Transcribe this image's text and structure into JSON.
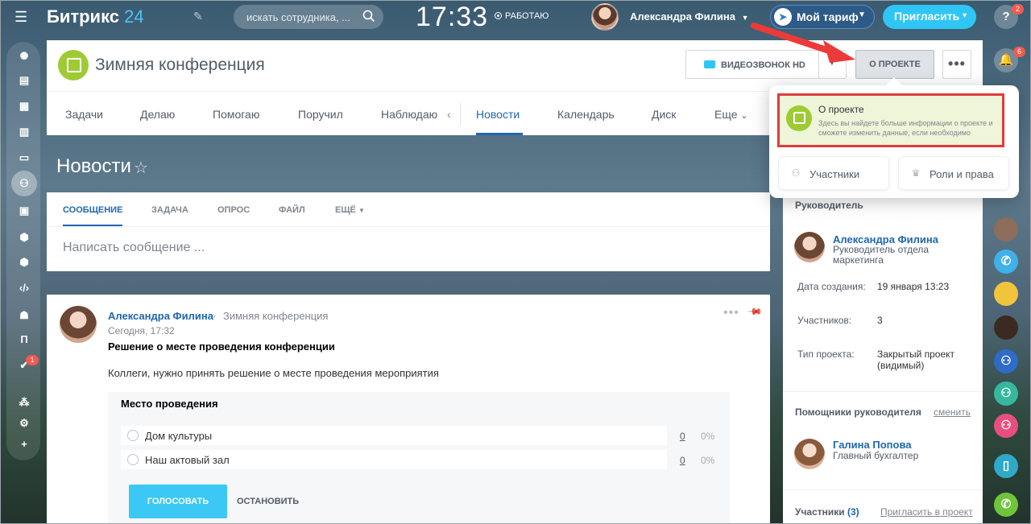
{
  "topbar": {
    "logo_text": "Битрикс",
    "logo_num": "24",
    "search_placeholder": "искать сотрудника, ...",
    "time": "17:33",
    "work_status": "РАБОТАЮ",
    "user_name": "Александра Филина",
    "tariff_label": "Мой тариф",
    "invite_label": "Пригласить"
  },
  "left_sidebar": {
    "items": [
      "feed-icon",
      "tasks-icon",
      "calendar-icon",
      "docs-icon",
      "drive-icon",
      "groups-icon",
      "contacts-icon",
      "crm-icon",
      "store-icon",
      "developer-icon",
      "robot-icon",
      "п",
      "check-icon",
      "sites-icon",
      "settings-icon",
      "add-icon"
    ],
    "letter_item": "П",
    "badge": "1"
  },
  "right_sidebar": {
    "help_badge": "2",
    "bell_badge": "6"
  },
  "project": {
    "title": "Зимняя конференция",
    "video_button": "ВИДЕОЗВОНОК HD",
    "about_button": "О ПРОЕКТЕ",
    "more_button": "•••"
  },
  "tabs": {
    "items": [
      "Задачи",
      "Делаю",
      "Помогаю",
      "Поручил",
      "Наблюдаю",
      "Новости",
      "Календарь",
      "Диск",
      "Еще"
    ],
    "active": "Новости"
  },
  "news": {
    "title": "Новости"
  },
  "post_form": {
    "tabs": [
      "СООБЩЕНИЕ",
      "ЗАДАЧА",
      "ОПРОС",
      "ФАЙЛ",
      "ЕЩЁ"
    ],
    "placeholder": "Написать сообщение ..."
  },
  "post": {
    "author": "Александра Филина",
    "destination": "Зимняя конференция",
    "time": "Сегодня, 17:32",
    "headline": "Решение о месте проведения конференции",
    "text": "Коллеги, нужно принять решение о месте проведения мероприятия",
    "vote": {
      "title": "Место проведения",
      "options": [
        {
          "label": "Дом культуры",
          "count": "0",
          "pct": "0%"
        },
        {
          "label": "Наш актовый зал",
          "count": "0",
          "pct": "0%"
        }
      ],
      "vote_button": "ГОЛОСОВАТЬ",
      "stop_button": "ОСТАНОВИТЬ"
    }
  },
  "popup": {
    "title": "О проекте",
    "description": "Здесь вы найдете больше информации о проекте и сможете изменить данные, если необходимо",
    "members_button": "Участники",
    "roles_button": "Роли и права"
  },
  "right_panel": {
    "owner_title": "Руководитель",
    "owner_name": "Александра Филина",
    "owner_position": "Руководитель отдела маркетинга",
    "created_label": "Дата создания:",
    "created_value": "19 января 13:23",
    "members_label": "Участников:",
    "members_value": "3",
    "type_label": "Тип проекта:",
    "type_value": "Закрытый проект (видимый)",
    "helpers_title": "Помощники руководителя",
    "change_link": "сменить",
    "helper_name": "Галина Попова",
    "helper_position": "Главный бухгалтер",
    "participants_title": "Участники",
    "participants_count": "(3)",
    "invite_link": "Пригласить в проект"
  },
  "colors": {
    "accent": "#2067b0",
    "brand_blue": "#2fc6f6",
    "project_green": "#9ecb34",
    "highlight_red": "#e23a3a"
  }
}
